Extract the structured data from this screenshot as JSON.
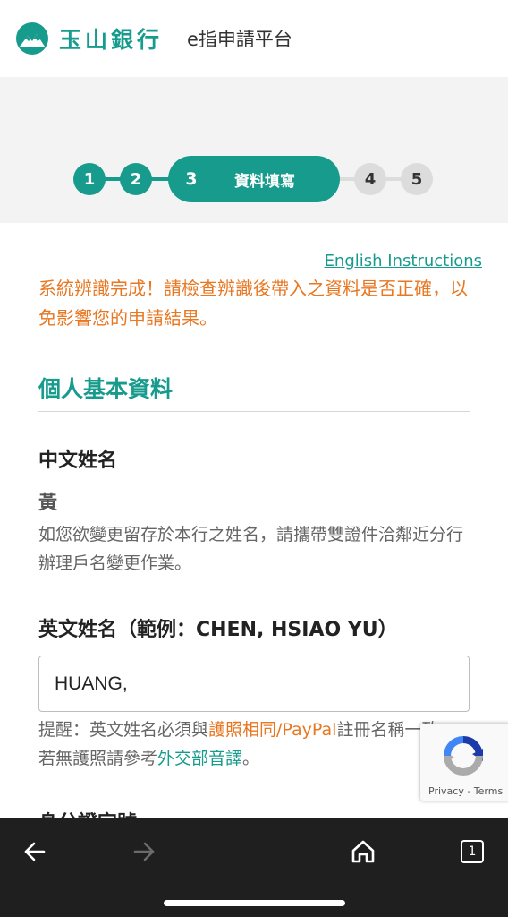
{
  "header": {
    "brand": "玉山銀行",
    "platform": "e指申請平台",
    "logo_icon": "mountain-logo-icon",
    "brand_color": "#179b8d"
  },
  "stepper": {
    "steps": [
      "1",
      "2",
      "3",
      "4",
      "5"
    ],
    "active_step": "3",
    "active_label": "資料填寫"
  },
  "content": {
    "english_link": "English Instructions",
    "notice": "系統辨識完成！請檢查辨識後帶入之資料是否正確，以免影響您的申請結果。",
    "section_title": "個人基本資料",
    "chinese_name": {
      "label": "中文姓名",
      "value": "黃",
      "hint": "如您欲變更留存於本行之姓名，請攜帶雙證件洽鄰近分行辦理戶名變更作業。"
    },
    "english_name": {
      "label": "英文姓名（範例：CHEN, HSIAO YU）",
      "value": "HUANG,",
      "hint_prefix": "提醒：英文姓名必須與",
      "hint_highlight": "護照相同/PayPal",
      "hint_middle": "註冊名稱一致，若無護照請參考",
      "hint_link": "外交部音譯",
      "hint_suffix": "。"
    },
    "next_label": "身分證字號"
  },
  "recaptcha": {
    "text": "Privacy - Terms"
  },
  "bottom_nav": {
    "back_icon": "arrow-left-icon",
    "forward_icon": "arrow-right-icon",
    "home_icon": "home-icon",
    "tab_count": "1"
  },
  "colors": {
    "accent": "#179b8d",
    "warning": "#e87722",
    "inactive_step": "#dcdcdc"
  }
}
